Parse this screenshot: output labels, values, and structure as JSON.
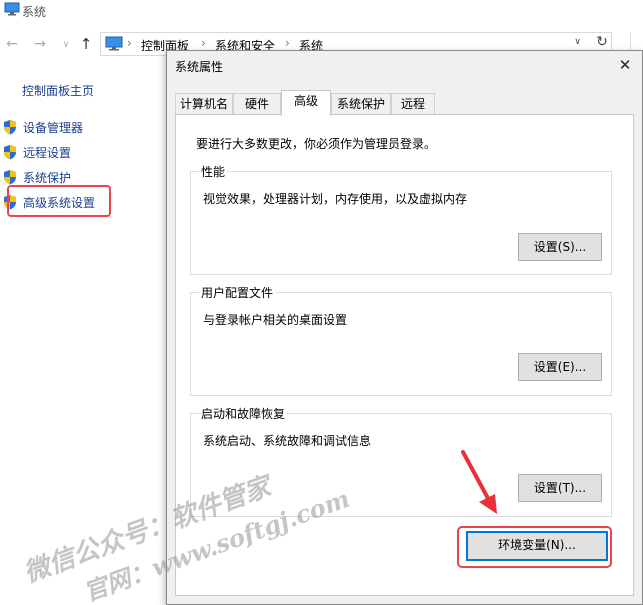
{
  "window": {
    "title": "系统"
  },
  "address": {
    "crumbs": [
      "控制面板",
      "系统和安全",
      "系统"
    ]
  },
  "leftpane": {
    "home_link": "控制面板主页",
    "items": [
      {
        "label": "设备管理器"
      },
      {
        "label": "远程设置"
      },
      {
        "label": "系统保护"
      },
      {
        "label": "高级系统设置"
      }
    ]
  },
  "dialog": {
    "title": "系统属性",
    "tabs": [
      {
        "label": "计算机名"
      },
      {
        "label": "硬件"
      },
      {
        "label": "高级"
      },
      {
        "label": "系统保护"
      },
      {
        "label": "远程"
      }
    ],
    "active_tab": "高级",
    "admin_note": "要进行大多数更改，你必须作为管理员登录。",
    "performance": {
      "legend": "性能",
      "description": "视觉效果，处理器计划，内存使用，以及虚拟内存",
      "button": "设置(S)..."
    },
    "user_profiles": {
      "legend": "用户配置文件",
      "description": "与登录帐户相关的桌面设置",
      "button": "设置(E)..."
    },
    "startup_recovery": {
      "legend": "启动和故障恢复",
      "description": "系统启动、系统故障和调试信息",
      "button": "设置(T)..."
    },
    "env_button": "环境变量(N)..."
  },
  "watermark": {
    "line1": "微信公众号：软件管家",
    "line2": "官网：www.softgj.com"
  },
  "colors": {
    "highlight": "#e8454d",
    "link": "#1a3e8c",
    "focus": "#0078d7"
  }
}
